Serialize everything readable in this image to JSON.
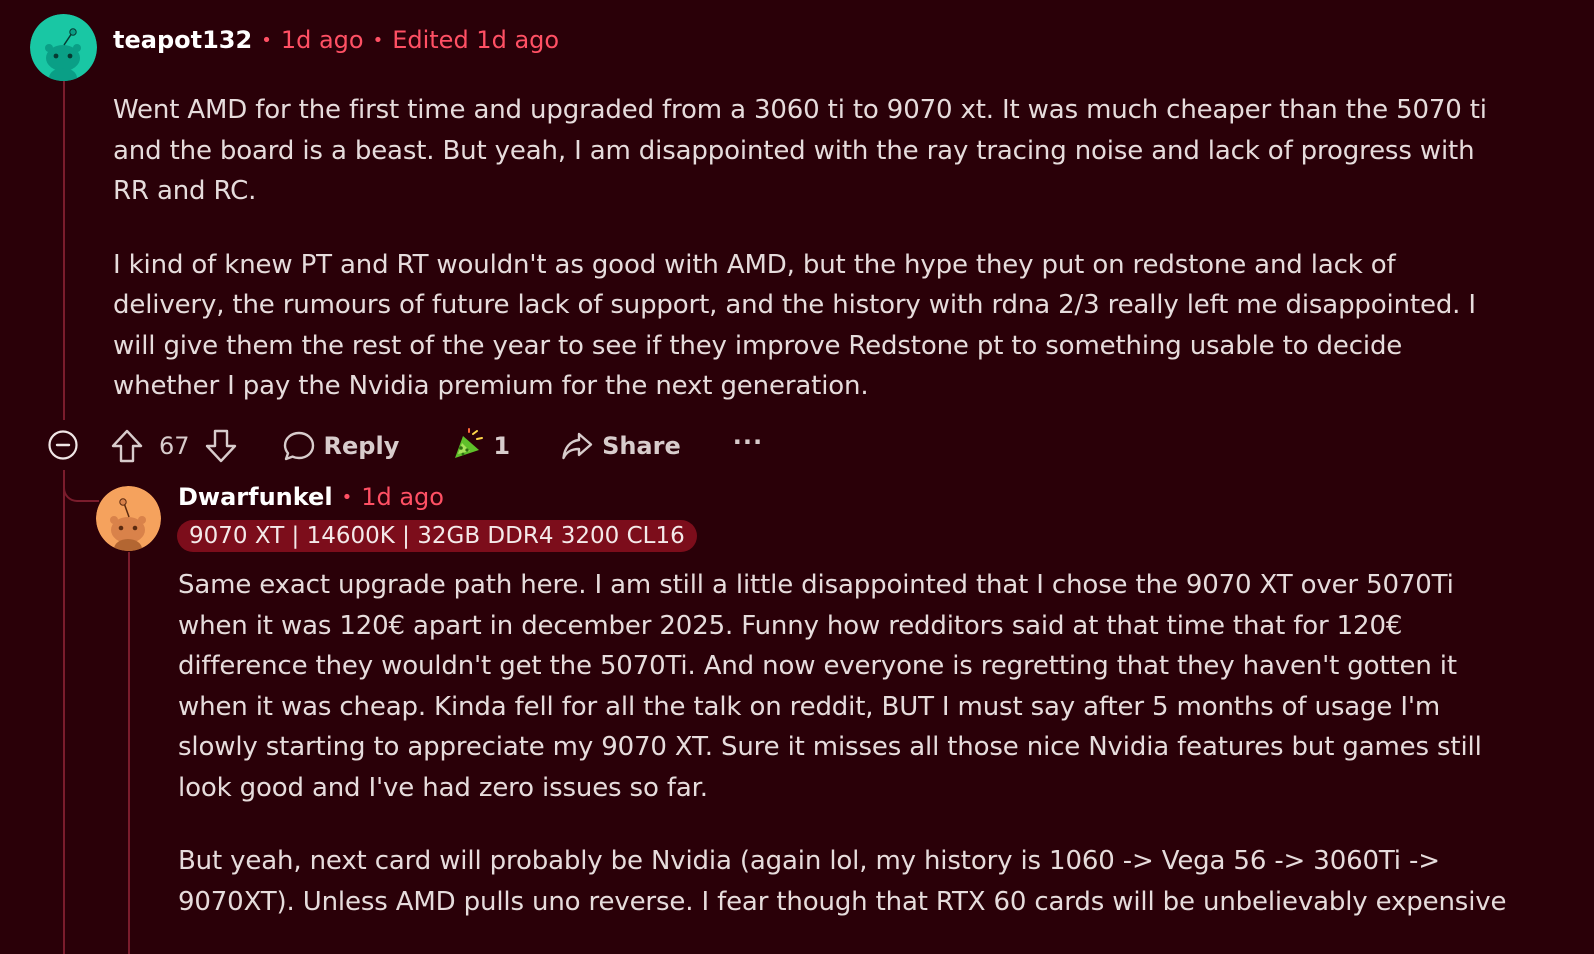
{
  "comment": {
    "username": "teapot132",
    "time": "1d ago",
    "edited": "Edited 1d ago",
    "paragraphs": [
      "Went AMD for the first time and upgraded from a 3060 ti to 9070 xt. It was much cheaper than the 5070 ti and the board is a beast. But yeah, I am disappointed with the ray tracing noise and lack of progress with RR and RC.",
      "I kind of knew PT and RT wouldn't as good with AMD, but the hype they put on redstone and lack of delivery, the rumours of future lack of support, and the history with rdna 2/3 really left me disappointed. I will give them the rest of the year to see if they improve Redstone pt to something usable to decide whether I pay the Nvidia premium for the next generation."
    ],
    "score": "67",
    "reply_label": "Reply",
    "award_count": "1",
    "share_label": "Share",
    "more_label": "···",
    "avatar_color": "#19c7a4"
  },
  "reply": {
    "username": "Dwarfunkel",
    "time": "1d ago",
    "flair": "9070 XT | 14600K | 32GB DDR4 3200 CL16",
    "paragraphs": [
      "Same exact upgrade path here. I am still a little disappointed that I chose the 9070 XT over 5070Ti when it was 120€ apart in december 2025. Funny how redditors said at that time that for 120€ difference they wouldn't get the 5070Ti. And now everyone is regretting that they haven't gotten it when it was cheap. Kinda fell for all the talk on reddit, BUT I must say after 5 months of usage I'm slowly starting to appreciate my 9070 XT. Sure it misses all those nice Nvidia features but games still look good and I've had zero issues so far.",
      "But yeah, next card will probably be Nvidia (again lol, my history is 1060 -> Vega 56 -> 3060Ti -> 9070XT). Unless AMD pulls uno reverse. I fear though that RTX 60 cards will be unbelievably expensive"
    ],
    "avatar_color": "#f5a25d"
  },
  "icons": {
    "collapse": "minus-circle-icon",
    "upvote": "arrow-up-icon",
    "downvote": "arrow-down-icon",
    "reply": "speech-bubble-icon",
    "award": "award-icon",
    "share": "share-arrow-icon",
    "more": "ellipsis-icon"
  },
  "colors": {
    "background": "#2a0008",
    "accent": "#ff5064",
    "thread_line": "#7a1c2c",
    "flair_bg": "#7c0d1b"
  }
}
